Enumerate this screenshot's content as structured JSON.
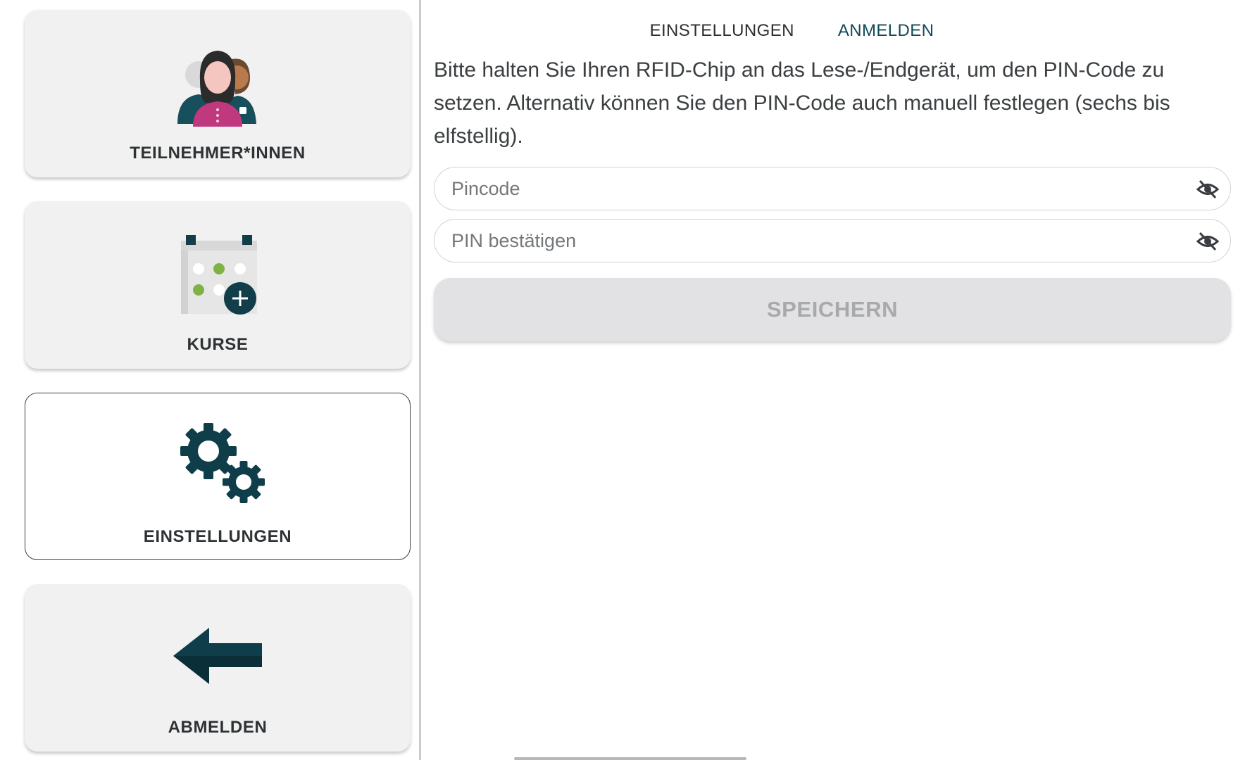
{
  "sidebar": {
    "items": [
      {
        "label": "TEILNEHMER*INNEN",
        "icon": "participants-icon",
        "active": false
      },
      {
        "label": "KURSE",
        "icon": "course-calendar-icon",
        "active": false
      },
      {
        "label": "EINSTELLUNGEN",
        "icon": "gears-icon",
        "active": true
      },
      {
        "label": "ABMELDEN",
        "icon": "arrow-left-icon",
        "active": false
      }
    ]
  },
  "tabs": [
    {
      "label": "EINSTELLUNGEN",
      "selected": false
    },
    {
      "label": "ANMELDEN",
      "selected": true
    }
  ],
  "main": {
    "instructions": "Bitte halten Sie Ihren RFID-Chip an das Lese-/Endgerät, um den PIN-Code zu setzen. Alternativ können Sie den PIN-Code auch manuell festlegen (sechs bis elfstellig).",
    "pin_field": {
      "placeholder": "Pincode",
      "value": ""
    },
    "pin_confirm_field": {
      "placeholder": "PIN bestätigen",
      "value": ""
    },
    "save_label": "SPEICHERN"
  },
  "colors": {
    "accent": "#114b5a",
    "icon_dark": "#0f3d4a",
    "green": "#7cb342",
    "tile_bg": "#f1f1f1",
    "button_disabled_bg": "#e2e2e4",
    "button_disabled_text": "#a7a9ab"
  }
}
